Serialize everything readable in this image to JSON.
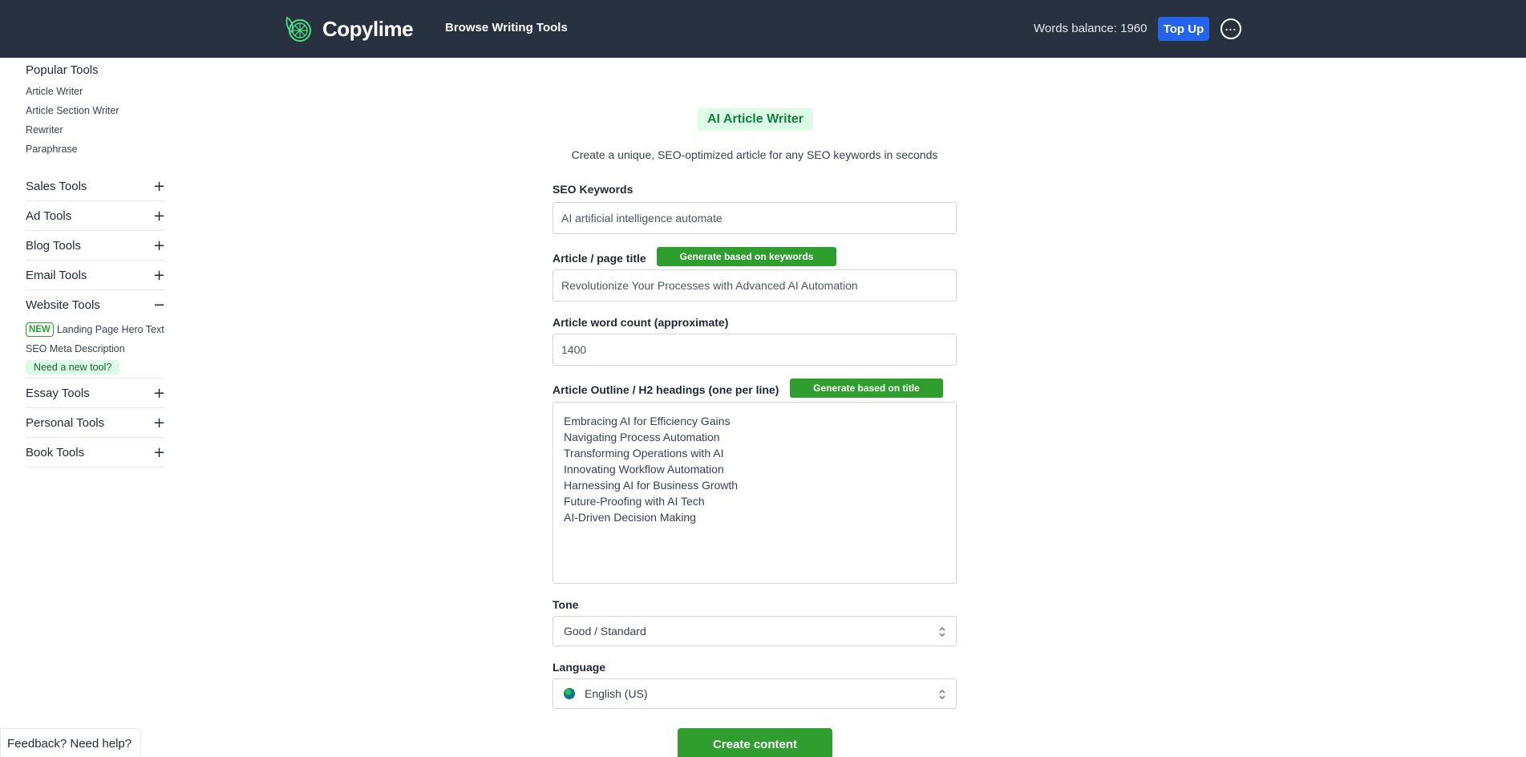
{
  "header": {
    "brand": "Copylime",
    "browse_label": "Browse Writing Tools",
    "words_balance": "Words balance: 1960",
    "topup_label": "Top Up",
    "more_icon": "ellipsis-icon"
  },
  "sidebar": {
    "popular_heading": "Popular Tools",
    "popular_links": [
      "Article Writer",
      "Article Section Writer",
      "Rewriter",
      "Paraphrase"
    ],
    "categories": [
      {
        "label": "Sales Tools",
        "toggle": "+"
      },
      {
        "label": "Ad Tools",
        "toggle": "+"
      },
      {
        "label": "Blog Tools",
        "toggle": "+"
      },
      {
        "label": "Email Tools",
        "toggle": "+"
      },
      {
        "label": "Website Tools",
        "toggle": "−"
      },
      {
        "label": "Essay Tools",
        "toggle": "+"
      },
      {
        "label": "Personal Tools",
        "toggle": "+"
      },
      {
        "label": "Book Tools",
        "toggle": "+"
      }
    ],
    "website_tools": {
      "new_badge": "NEW",
      "items": [
        "Landing Page Hero Text",
        "SEO Meta Description"
      ],
      "need_tool": "Need a new tool?"
    }
  },
  "form": {
    "title_badge": "AI Article Writer",
    "subtitle": "Create a unique, SEO-optimized article for any SEO keywords in seconds",
    "keywords_label": "SEO Keywords",
    "keywords_value": "AI artificial intelligence automate",
    "title_label": "Article / page title",
    "title_generate": "Generate based on keywords",
    "title_value": "Revolutionize Your Processes with Advanced AI Automation",
    "wordcount_label": "Article word count (approximate)",
    "wordcount_value": "1400",
    "outline_label": "Article Outline / H2 headings (one per line)",
    "outline_generate": "Generate based on title",
    "outline_lines": [
      "Embracing AI for Efficiency Gains",
      "Navigating Process Automation",
      "Transforming Operations with AI",
      "Innovating Workflow Automation",
      "Harnessing AI for Business Growth",
      "Future-Proofing with AI Tech",
      "AI-Driven Decision Making"
    ],
    "tone_label": "Tone",
    "tone_value": "Good / Standard",
    "language_label": "Language",
    "language_value": "English (US)",
    "create_label": "Create content"
  },
  "feedback_label": "Feedback? Need help?",
  "colors": {
    "navbar": "#283140",
    "accent_green": "#2f9e2f",
    "topup_blue": "#2563eb",
    "badge_bg": "#dcfce7"
  }
}
